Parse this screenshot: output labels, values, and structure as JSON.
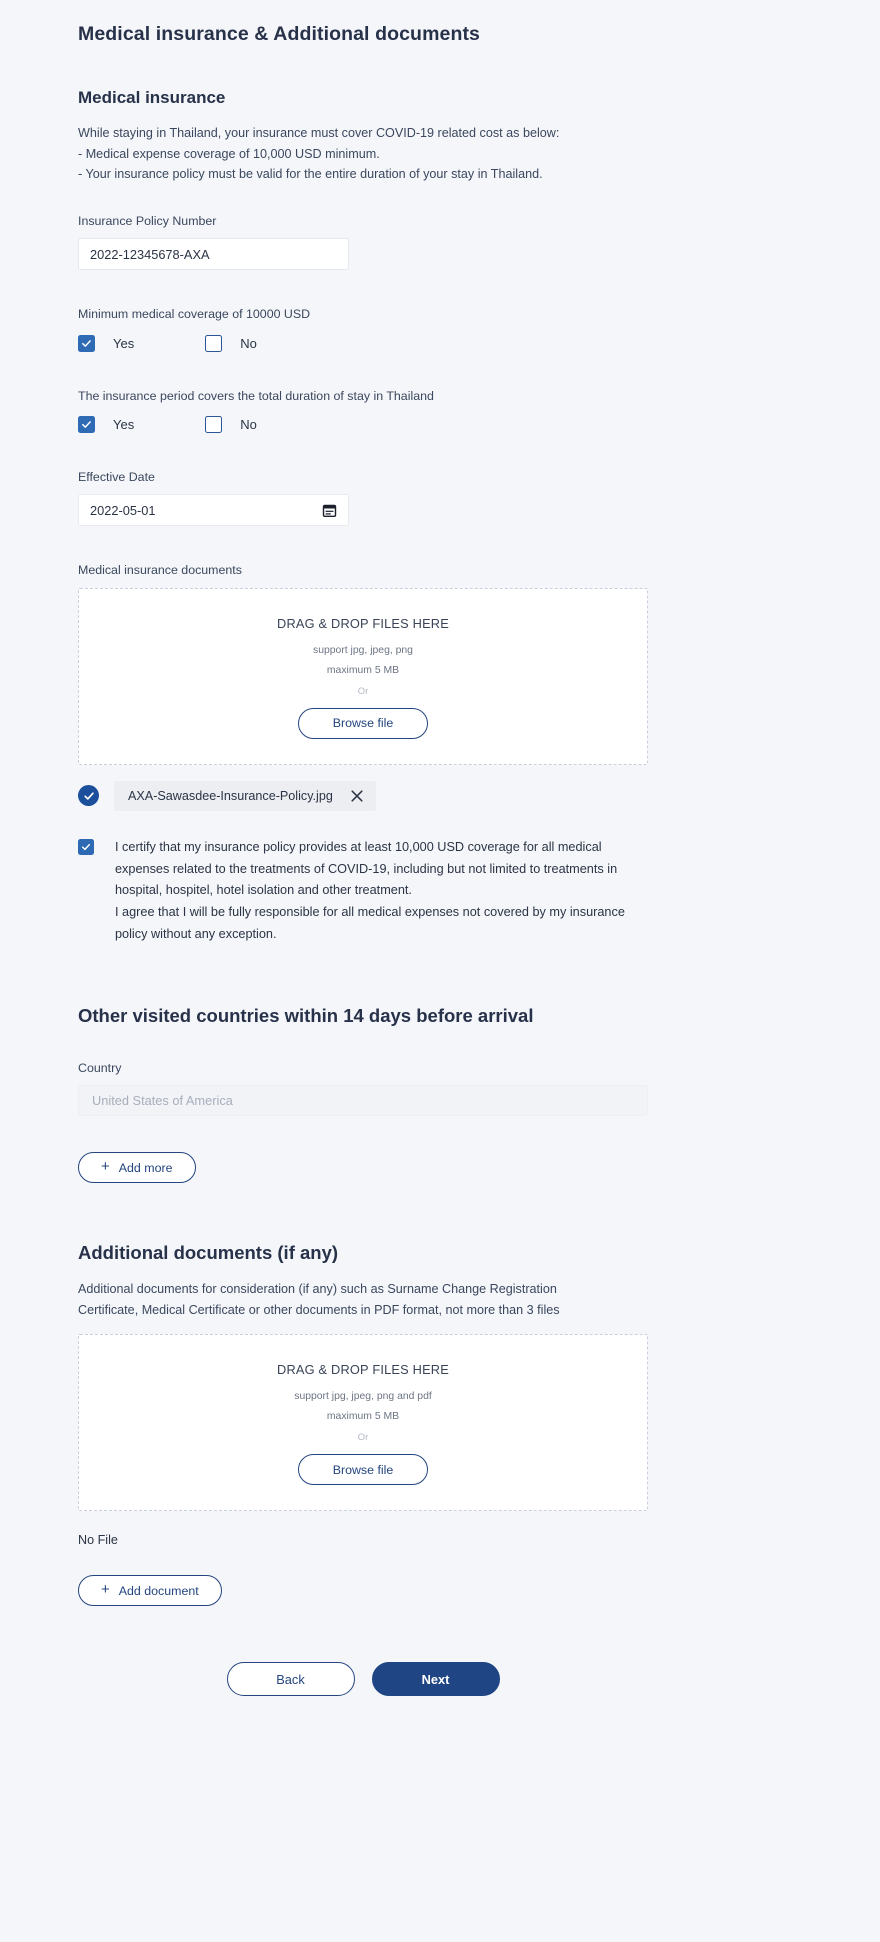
{
  "page": {
    "title": "Medical insurance & Additional documents"
  },
  "medical_insurance": {
    "heading": "Medical insurance",
    "description_lines": [
      "While staying in Thailand, your insurance must cover COVID-19 related cost as below:",
      "- Medical expense coverage of 10,000 USD minimum.",
      "- Your insurance policy must be valid for the entire duration of your stay in Thailand."
    ],
    "policy_number": {
      "label": "Insurance Policy Number",
      "value": "2022-12345678-AXA"
    },
    "coverage_question": {
      "label": "Minimum medical coverage of 10000 USD",
      "yes_label": "Yes",
      "no_label": "No",
      "selected": "Yes"
    },
    "period_question": {
      "label": "The insurance period covers the total duration of stay in Thailand",
      "yes_label": "Yes",
      "no_label": "No",
      "selected": "Yes"
    },
    "effective_date": {
      "label": "Effective Date",
      "value": "2022-05-01",
      "icon": "calendar-icon"
    },
    "documents": {
      "label": "Medical insurance documents",
      "dropzone": {
        "title": "DRAG & DROP FILES HERE",
        "support": "support jpg, jpeg, png",
        "maximum": "maximum 5 MB",
        "or": "Or",
        "browse_label": "Browse file"
      },
      "uploaded_file": {
        "name": "AXA-Sawasdee-Insurance-Policy.jpg",
        "status_icon": "check-circle-icon",
        "remove_icon": "close-icon"
      }
    },
    "certification": {
      "checked": true,
      "paragraph_1": "I certify that my insurance policy provides at least 10,000 USD coverage for all medical expenses related to the treatments of COVID-19, including but not limited to treatments in hospital, hospitel, hotel isolation and other treatment.",
      "paragraph_2": "I agree that I will be fully responsible for all medical expenses not covered by my insurance policy without any exception."
    }
  },
  "other_countries": {
    "heading": "Other visited countries within 14 days before arrival",
    "country": {
      "label": "Country",
      "value": "",
      "placeholder": "United States of America"
    },
    "add_more_label": "Add more",
    "add_more_icon": "plus-icon"
  },
  "additional_documents": {
    "heading": "Additional documents (if any)",
    "description_lines": [
      "Additional documents for consideration (if any) such as Surname Change Registration",
      "Certificate, Medical Certificate or other documents in PDF format, not more than 3 files"
    ],
    "dropzone": {
      "title": "DRAG & DROP FILES HERE",
      "support": "support jpg, jpeg, png and pdf",
      "maximum": "maximum 5 MB",
      "or": "Or",
      "browse_label": "Browse file"
    },
    "no_file_label": "No File",
    "add_document_label": "Add document",
    "add_document_icon": "plus-icon"
  },
  "footer": {
    "back_label": "Back",
    "next_label": "Next"
  },
  "colors": {
    "background": "#f4f6f9",
    "primary": "#1f4584",
    "accent_blue": "#2f6ab5",
    "text": "#2b3445",
    "muted": "#6d7585",
    "placeholder": "#a8aebb"
  }
}
